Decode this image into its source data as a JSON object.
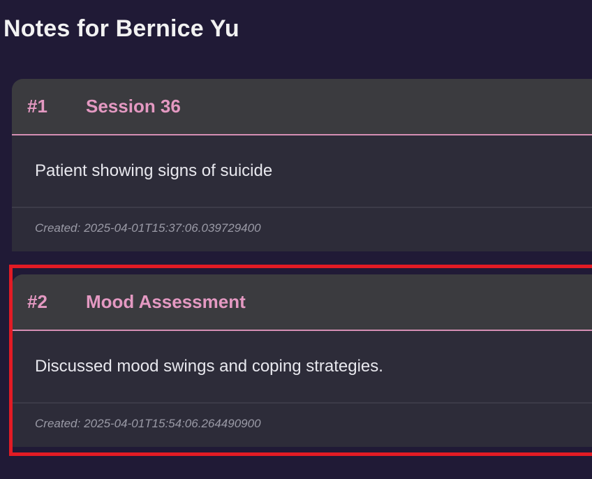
{
  "page": {
    "title": "Notes for Bernice Yu"
  },
  "notes": [
    {
      "number": "#1",
      "title": "Session 36",
      "body": "Patient showing signs of suicide",
      "created_label": "Created:",
      "created": "2025-04-01T15:37:06.039729400"
    },
    {
      "number": "#2",
      "title": "Mood Assessment",
      "body": "Discussed mood swings and coping strategies.",
      "created_label": "Created:",
      "created": "2025-04-01T15:54:06.264490900"
    }
  ],
  "colors": {
    "background": "#201a36",
    "accent": "#e499c2",
    "highlight": "#e21b24"
  }
}
